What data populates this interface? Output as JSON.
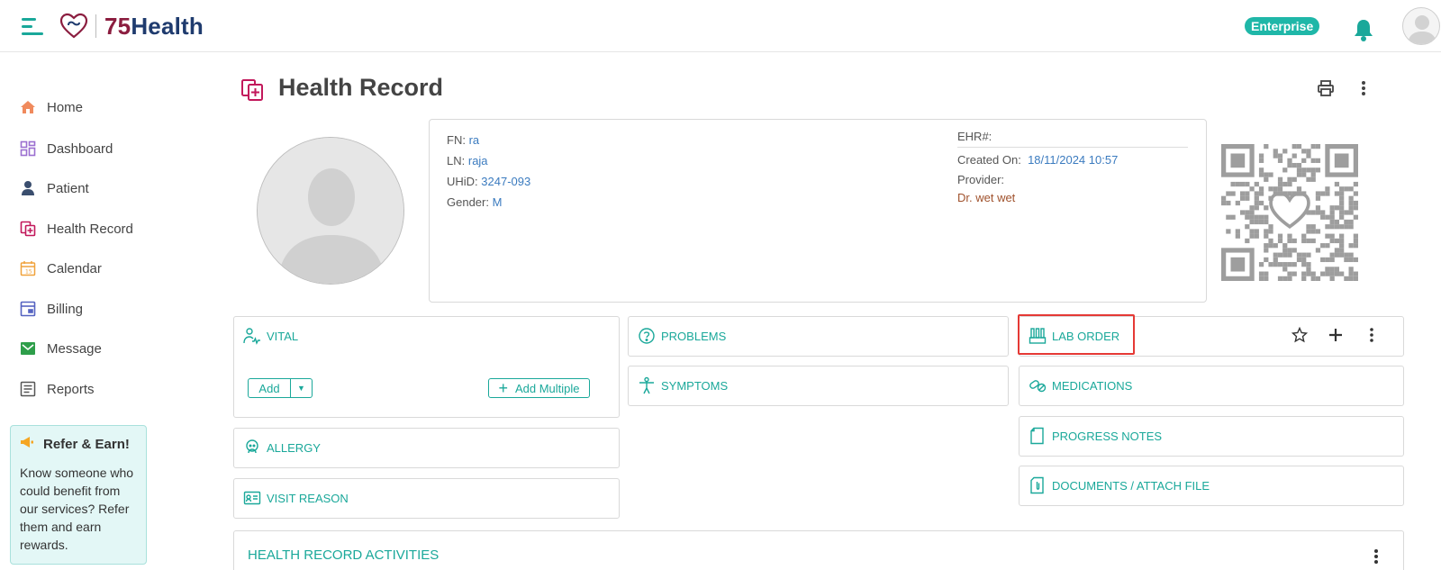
{
  "header": {
    "brand_num": "75",
    "brand_name": "Health",
    "plan_badge": "Enterprise"
  },
  "sidebar": {
    "items": [
      {
        "label": "Home",
        "icon": "home-icon"
      },
      {
        "label": "Dashboard",
        "icon": "dashboard-icon"
      },
      {
        "label": "Patient",
        "icon": "patient-icon"
      },
      {
        "label": "Health Record",
        "icon": "health-record-icon"
      },
      {
        "label": "Calendar",
        "icon": "calendar-icon"
      },
      {
        "label": "Billing",
        "icon": "billing-icon"
      },
      {
        "label": "Message",
        "icon": "message-icon"
      },
      {
        "label": "Reports",
        "icon": "reports-icon"
      }
    ],
    "refer": {
      "title": "Refer & Earn!",
      "body": "Know someone who could benefit from our services? Refer them and earn rewards."
    }
  },
  "page": {
    "title": "Health Record"
  },
  "patient": {
    "fn_label": "FN:",
    "fn": "ra",
    "ln_label": "LN:",
    "ln": "raja",
    "uhid_label": "UHiD:",
    "uhid": "3247-093",
    "gender_label": "Gender:",
    "gender": "M",
    "ehr_label": "EHR#:",
    "ehr": "",
    "created_label": "Created On:",
    "created": "18/11/2024 10:57",
    "provider_label": "Provider:",
    "provider": "Dr. wet wet"
  },
  "panels": {
    "vital": {
      "title": "VITAL",
      "add": "Add",
      "add_multiple": "Add Multiple"
    },
    "allergy": {
      "title": "ALLERGY"
    },
    "visit_reason": {
      "title": "VISIT REASON"
    },
    "problems": {
      "title": "PROBLEMS"
    },
    "symptoms": {
      "title": "SYMPTOMS"
    },
    "lab_order": {
      "title": "LAB ORDER"
    },
    "medications": {
      "title": "MEDICATIONS"
    },
    "progress_notes": {
      "title": "PROGRESS NOTES"
    },
    "documents": {
      "title": "DOCUMENTS / ATTACH FILE"
    },
    "activities": {
      "title": "HEALTH RECORD ACTIVITIES"
    }
  },
  "colors": {
    "accent": "#1aa89a",
    "brand_maroon": "#8b1d3f",
    "brand_navy": "#1f3b6e",
    "annotation_red": "#e53935"
  }
}
